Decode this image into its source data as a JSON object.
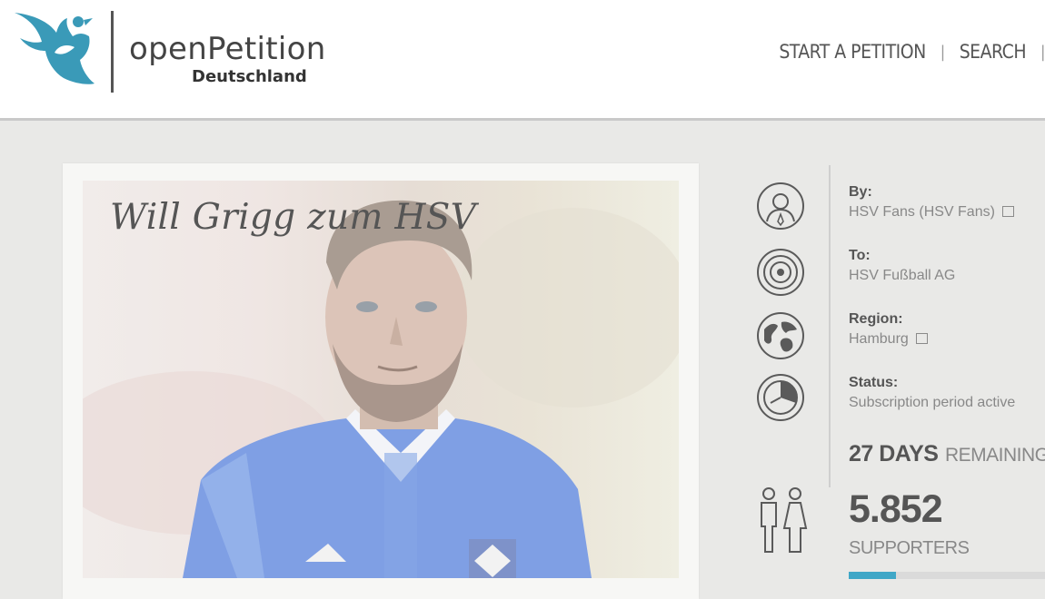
{
  "brand": {
    "name": "openPetition",
    "subtitle": "Deutschland",
    "accent": "#3a9ab8"
  },
  "nav": {
    "items": [
      "START A PETITION",
      "SEARCH"
    ],
    "separator": "|"
  },
  "petition": {
    "image_title": "Will Grigg zum HSV",
    "by_label": "By:",
    "by_value": "HSV Fans (HSV Fans)",
    "to_label": "To:",
    "to_value": "HSV Fußball AG",
    "region_label": "Region:",
    "region_value": "Hamburg",
    "status_label": "Status:",
    "status_value": "Subscription period active",
    "days_count": "27 DAYS",
    "days_text": "REMAINING",
    "supporters_count": "5.852",
    "supporters_label": "SUPPORTERS",
    "progress_fraction": 0.24,
    "progress_color": "#3fa7c7"
  },
  "icons": {
    "by": "user-pin-icon",
    "to": "target-icon",
    "region": "globe-icon",
    "status": "clock-icon",
    "supporters": "people-icon"
  }
}
